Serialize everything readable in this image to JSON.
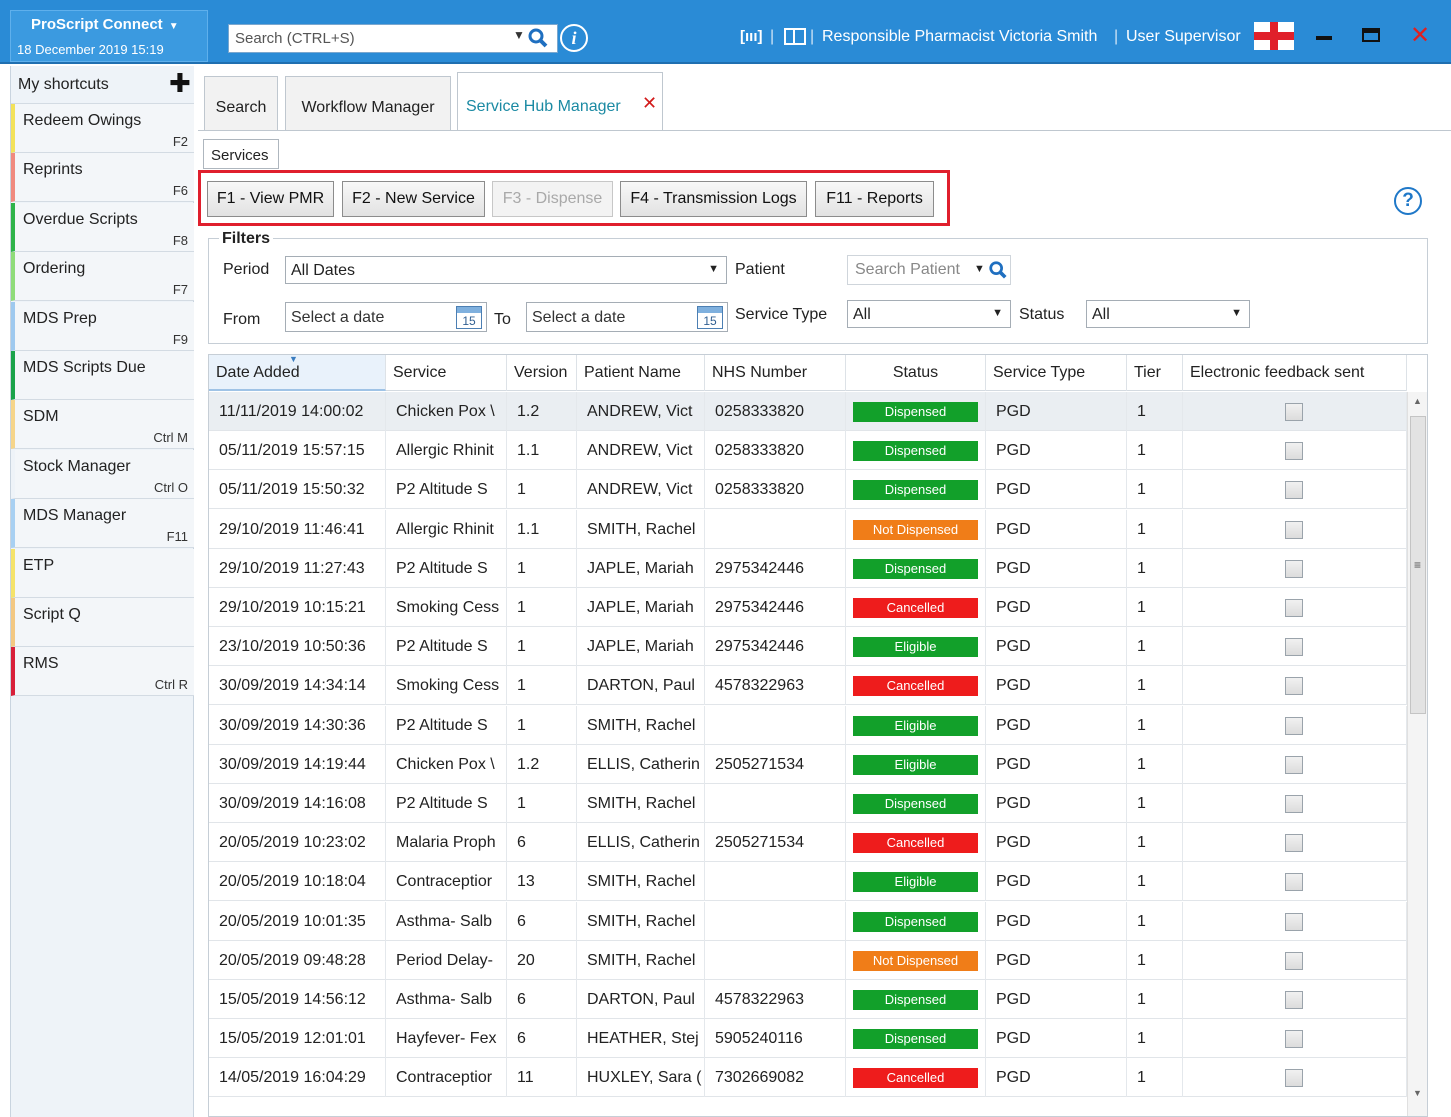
{
  "app": {
    "name": "ProScript Connect",
    "date": "18 December 2019 15:19"
  },
  "header": {
    "search_placeholder": "Search (CTRL+S)",
    "barcode_icon": "barcode-icon",
    "card_icon": "id-card-icon",
    "pharmacist": "Responsible Pharmacist Victoria Smith",
    "user": "User Supervisor",
    "separator": "|",
    "close_glyph": "✕"
  },
  "sidebar": {
    "title": "My shortcuts",
    "add_glyph": "✚",
    "items": [
      {
        "label": "Redeem Owings",
        "key": "F2",
        "color": "#f3e25a"
      },
      {
        "label": "Reprints",
        "key": "F6",
        "color": "#f08a7f"
      },
      {
        "label": "Overdue Scripts",
        "key": "F8",
        "color": "#2fb34a"
      },
      {
        "label": "Ordering",
        "key": "F7",
        "color": "#8fdc7a"
      },
      {
        "label": "MDS Prep",
        "key": "F9",
        "color": "#9ec9ef"
      },
      {
        "label": "MDS Scripts Due",
        "key": "",
        "color": "#1aa34a"
      },
      {
        "label": "SDM",
        "key": "Ctrl M",
        "color": "#f6d58a"
      },
      {
        "label": "Stock Manager",
        "key": "Ctrl O",
        "color": "#eef3f8"
      },
      {
        "label": "MDS Manager",
        "key": "F11",
        "color": "#a8d0f2"
      },
      {
        "label": "ETP",
        "key": "",
        "color": "#f5e36a"
      },
      {
        "label": "Script Q",
        "key": "",
        "color": "#f3c882"
      },
      {
        "label": "RMS",
        "key": "Ctrl R",
        "color": "#d8203a"
      }
    ]
  },
  "tabs": {
    "search": "Search",
    "workflow": "Workflow Manager",
    "service_hub": "Service Hub Manager",
    "close_glyph": "✕"
  },
  "subtab": "Services",
  "toolbar": {
    "view_pmr": "F1 - View PMR",
    "new_service": "F2 - New Service",
    "dispense": "F3 - Dispense",
    "transmission_logs": "F4 - Transmission Logs",
    "reports": "F11 - Reports",
    "help_glyph": "?"
  },
  "filters": {
    "legend": "Filters",
    "period_label": "Period",
    "period_value": "All Dates",
    "patient_label": "Patient",
    "patient_placeholder": "Search Patient",
    "from_label": "From",
    "from_value": "Select a date",
    "to_label": "To",
    "to_value": "Select a date",
    "calendar_day": "15",
    "service_type_label": "Service Type",
    "service_type_value": "All",
    "status_label": "Status",
    "status_value": "All"
  },
  "status_colors": {
    "Dispensed": "#12a02a",
    "Not Dispensed": "#f07d18",
    "Cancelled": "#ee1c1c",
    "Eligible": "#12a02a"
  },
  "table": {
    "columns": [
      "Date Added",
      "Service",
      "Version",
      "Patient Name",
      "NHS Number",
      "Status",
      "Service Type",
      "Tier",
      "Electronic feedback sent"
    ],
    "rows": [
      {
        "date": "11/11/2019 14:00:02",
        "service": "Chicken Pox \\",
        "version": "1.2",
        "patient": "ANDREW, Vict",
        "nhs": "0258333820",
        "status": "Dispensed",
        "type": "PGD",
        "tier": "1"
      },
      {
        "date": "05/11/2019 15:57:15",
        "service": "Allergic Rhinit",
        "version": "1.1",
        "patient": "ANDREW, Vict",
        "nhs": "0258333820",
        "status": "Dispensed",
        "type": "PGD",
        "tier": "1"
      },
      {
        "date": "05/11/2019 15:50:32",
        "service": "P2 Altitude S",
        "version": "1",
        "patient": "ANDREW, Vict",
        "nhs": "0258333820",
        "status": "Dispensed",
        "type": "PGD",
        "tier": "1"
      },
      {
        "date": "29/10/2019 11:46:41",
        "service": "Allergic Rhinit",
        "version": "1.1",
        "patient": "SMITH, Rachel",
        "nhs": "",
        "status": "Not Dispensed",
        "type": "PGD",
        "tier": "1"
      },
      {
        "date": "29/10/2019 11:27:43",
        "service": "P2 Altitude S",
        "version": "1",
        "patient": "JAPLE, Mariah",
        "nhs": "2975342446",
        "status": "Dispensed",
        "type": "PGD",
        "tier": "1"
      },
      {
        "date": "29/10/2019 10:15:21",
        "service": "Smoking Cess",
        "version": "1",
        "patient": "JAPLE, Mariah",
        "nhs": "2975342446",
        "status": "Cancelled",
        "type": "PGD",
        "tier": "1"
      },
      {
        "date": "23/10/2019 10:50:36",
        "service": "P2 Altitude S",
        "version": "1",
        "patient": "JAPLE, Mariah",
        "nhs": "2975342446",
        "status": "Eligible",
        "type": "PGD",
        "tier": "1"
      },
      {
        "date": "30/09/2019 14:34:14",
        "service": "Smoking Cess",
        "version": "1",
        "patient": "DARTON, Paul",
        "nhs": "4578322963",
        "status": "Cancelled",
        "type": "PGD",
        "tier": "1"
      },
      {
        "date": "30/09/2019 14:30:36",
        "service": "P2 Altitude S",
        "version": "1",
        "patient": "SMITH, Rachel",
        "nhs": "",
        "status": "Eligible",
        "type": "PGD",
        "tier": "1"
      },
      {
        "date": "30/09/2019 14:19:44",
        "service": "Chicken Pox \\",
        "version": "1.2",
        "patient": "ELLIS, Catherin",
        "nhs": "2505271534",
        "status": "Eligible",
        "type": "PGD",
        "tier": "1"
      },
      {
        "date": "30/09/2019 14:16:08",
        "service": "P2 Altitude S",
        "version": "1",
        "patient": "SMITH, Rachel",
        "nhs": "",
        "status": "Dispensed",
        "type": "PGD",
        "tier": "1"
      },
      {
        "date": "20/05/2019 10:23:02",
        "service": "Malaria Proph",
        "version": "6",
        "patient": "ELLIS, Catherin",
        "nhs": "2505271534",
        "status": "Cancelled",
        "type": "PGD",
        "tier": "1"
      },
      {
        "date": "20/05/2019 10:18:04",
        "service": "Contraceptior",
        "version": "13",
        "patient": "SMITH, Rachel",
        "nhs": "",
        "status": "Eligible",
        "type": "PGD",
        "tier": "1"
      },
      {
        "date": "20/05/2019 10:01:35",
        "service": "Asthma- Salb",
        "version": "6",
        "patient": "SMITH, Rachel",
        "nhs": "",
        "status": "Dispensed",
        "type": "PGD",
        "tier": "1"
      },
      {
        "date": "20/05/2019 09:48:28",
        "service": "Period Delay-",
        "version": "20",
        "patient": "SMITH, Rachel",
        "nhs": "",
        "status": "Not Dispensed",
        "type": "PGD",
        "tier": "1"
      },
      {
        "date": "15/05/2019 14:56:12",
        "service": "Asthma- Salb",
        "version": "6",
        "patient": "DARTON, Paul",
        "nhs": "4578322963",
        "status": "Dispensed",
        "type": "PGD",
        "tier": "1"
      },
      {
        "date": "15/05/2019 12:01:01",
        "service": "Hayfever- Fex",
        "version": "6",
        "patient": "HEATHER, Stej",
        "nhs": "5905240116",
        "status": "Dispensed",
        "type": "PGD",
        "tier": "1"
      },
      {
        "date": "14/05/2019 16:04:29",
        "service": "Contraceptior",
        "version": "11",
        "patient": "HUXLEY, Sara (",
        "nhs": "7302669082",
        "status": "Cancelled",
        "type": "PGD",
        "tier": "1"
      }
    ]
  }
}
